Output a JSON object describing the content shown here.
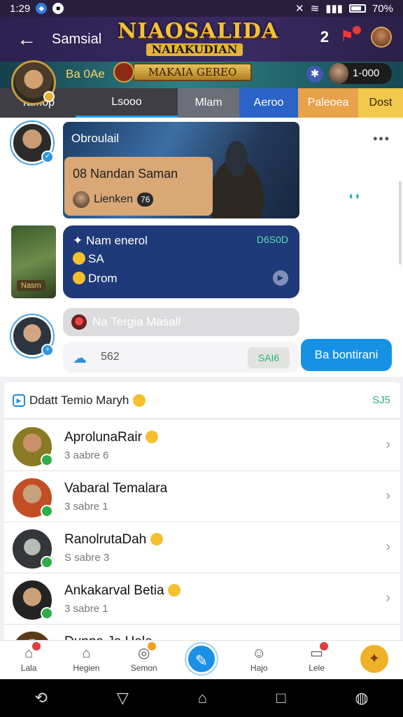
{
  "status_bar": {
    "time": "1:29",
    "battery": "70%"
  },
  "header": {
    "back_icon": "arrow-left-icon",
    "title": "Samsial",
    "logo_line1": "NIAOSALIDA",
    "logo_line2": "NAIAKUDIAN",
    "count": "2",
    "pin_icon": "pin-icon"
  },
  "banner": {
    "name": "Ba 0Ae",
    "plate": "MAKAIA GEREO",
    "coins": "1-000"
  },
  "tabs": [
    {
      "label": "Tamop",
      "bg": "#3e3e44",
      "color": "#ffffff",
      "active": false
    },
    {
      "label": "Lsooo",
      "bg": "#3e3e44",
      "color": "#ffffff",
      "active": true
    },
    {
      "label": "Mlam",
      "bg": "#6b6f78",
      "color": "#ffffff",
      "active": false
    },
    {
      "label": "Aeroo",
      "bg": "#2b63c8",
      "color": "#ffffff",
      "active": false
    },
    {
      "label": "Paleoea",
      "bg": "#e8a24a",
      "color": "#ffffff",
      "active": false
    },
    {
      "label": "Dost",
      "bg": "#f2c94c",
      "color": "#3a2a00",
      "active": false
    }
  ],
  "chat": {
    "scene_title": "Obroulail",
    "card_title": "Nandan Saman",
    "card_code": "08",
    "card_sub": "Lienken",
    "card_tag": "76",
    "blue_r1": "Nam enerol",
    "blue_r2": "SA",
    "blue_r3": "Drom",
    "blue_code": "D6S0D",
    "orc_label": "Nasm",
    "gray_text": "Na Tergia Masall",
    "input_num": "562",
    "input_pill": "SAI6",
    "send_label": "Ba bontirani"
  },
  "list": {
    "header_title": "Ddatt Temio Maryh",
    "header_right": "SJ5",
    "items": [
      {
        "name": "AprolunaRair",
        "sub": "3 aabre 6"
      },
      {
        "name": "Vabaral Temalara",
        "sub": "3 sabre 1"
      },
      {
        "name": "RanolrutaDah",
        "sub": "S sabre 3"
      },
      {
        "name": "Ankakarval Betia",
        "sub": "3 sabre 1"
      },
      {
        "name": "Dunna Ja Hale"
      }
    ]
  },
  "bottom_nav": [
    {
      "label": "Lala",
      "icon": "home-icon",
      "badge": true
    },
    {
      "label": "Hegien",
      "icon": "house-icon",
      "badge": false
    },
    {
      "label": "Semon",
      "icon": "search-icon",
      "badge": true
    },
    {
      "label": "",
      "icon": "compose-icon",
      "badge": false
    },
    {
      "label": "Hajo",
      "icon": "users-icon",
      "badge": false
    },
    {
      "label": "Lele",
      "icon": "laptop-icon",
      "badge": true
    },
    {
      "label": "",
      "icon": "wrench-icon",
      "badge": false
    }
  ]
}
